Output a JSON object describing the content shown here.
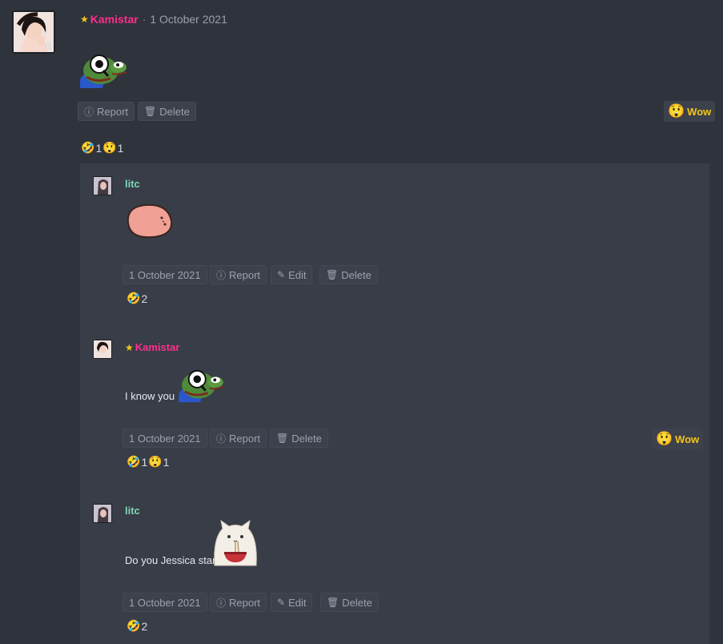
{
  "post": {
    "author": "Kamistar",
    "date": "1 October 2021",
    "report_label": "Report",
    "delete_label": "Delete",
    "wow_label": "Wow",
    "reactions": [
      {
        "emoji": "🤣",
        "count": "1"
      },
      {
        "emoji": "😲",
        "count": "1"
      }
    ]
  },
  "replies": [
    {
      "author": "litc",
      "date": "1 October 2021",
      "report_label": "Report",
      "edit_label": "Edit",
      "delete_label": "Delete",
      "reactions": [
        {
          "emoji": "🤣",
          "count": "2"
        }
      ]
    },
    {
      "author": "Kamistar",
      "text": "I know you",
      "date": "1 October 2021",
      "report_label": "Report",
      "delete_label": "Delete",
      "wow_label": "Wow",
      "reactions": [
        {
          "emoji": "🤣",
          "count": "1"
        },
        {
          "emoji": "😲",
          "count": "1"
        }
      ]
    },
    {
      "author": "litc",
      "text": "Do you Jessica stan",
      "date": "1 October 2021",
      "report_label": "Report",
      "edit_label": "Edit",
      "delete_label": "Delete",
      "reactions": [
        {
          "emoji": "🤣",
          "count": "2"
        }
      ]
    }
  ],
  "icons": {
    "report": "exclamation-circle-icon",
    "delete": "trash-icon",
    "edit": "pencil-square-icon",
    "star": "star-icon"
  },
  "colors": {
    "background": "#2f333c",
    "reply_panel": "#383d47",
    "author_staff": "#ff2d8c",
    "author_user": "#7fd6b6",
    "star": "#f5c518"
  }
}
